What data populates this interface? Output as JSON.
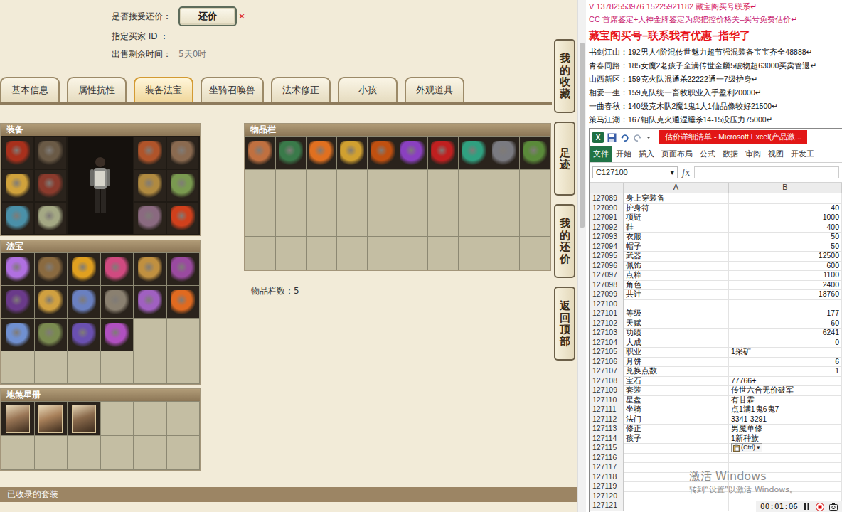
{
  "page": {
    "accept_offer": {
      "label": "是否接受还价：",
      "button": "还价",
      "mark": "✕"
    },
    "buyer": {
      "label": "指定买家 ID ："
    },
    "time_left": {
      "label": "出售剩余时间：",
      "value": "5天0时"
    },
    "tabs": [
      {
        "label": "基本信息",
        "selected": false
      },
      {
        "label": "属性抗性",
        "selected": false
      },
      {
        "label": "装备法宝",
        "selected": true
      },
      {
        "label": "坐骑召唤兽",
        "selected": false
      },
      {
        "label": "法术修正",
        "selected": false
      },
      {
        "label": "小孩",
        "selected": false
      },
      {
        "label": "外观道具",
        "selected": false
      }
    ],
    "equipment": {
      "title": "装备",
      "left_slots": [
        {
          "filled": true,
          "color": "#a8301c"
        },
        {
          "filled": true,
          "color": "#6a5a46"
        },
        {
          "filled": true,
          "color": "#d0a23c"
        },
        {
          "filled": true,
          "color": "#8a3a2c"
        },
        {
          "filled": true,
          "color": "#4a90a8"
        },
        {
          "filled": true,
          "color": "#a4a884"
        }
      ],
      "right_slots": [
        {
          "filled": true,
          "color": "#b0542a"
        },
        {
          "filled": true,
          "color": "#8a6a50"
        },
        {
          "filled": true,
          "color": "#b08a40"
        },
        {
          "filled": true,
          "color": "#7a9a50"
        },
        {
          "filled": true,
          "color": "#8a6a80"
        },
        {
          "filled": true,
          "color": "#d0401c"
        }
      ]
    },
    "magic": {
      "title": "法宝",
      "slots": [
        {
          "filled": true,
          "color": "#b070e0"
        },
        {
          "filled": true,
          "color": "#8a6a40"
        },
        {
          "filled": true,
          "color": "#e0a020"
        },
        {
          "filled": true,
          "color": "#d04a80"
        },
        {
          "filled": true,
          "color": "#c09040"
        },
        {
          "filled": true,
          "color": "#9a4aa0"
        },
        {
          "filled": true,
          "color": "#6a3a8a"
        },
        {
          "filled": true,
          "color": "#d0a040"
        },
        {
          "filled": true,
          "color": "#6a80c0"
        },
        {
          "filled": true,
          "color": "#8a8070"
        },
        {
          "filled": true,
          "color": "#a060c0"
        },
        {
          "filled": true,
          "color": "#e06a20"
        },
        {
          "filled": true,
          "color": "#7090d0"
        },
        {
          "filled": true,
          "color": "#7a8a50"
        },
        {
          "filled": true,
          "color": "#6a50b0"
        },
        {
          "filled": true,
          "color": "#b050c0"
        },
        {
          "filled": false
        },
        {
          "filled": false
        },
        {
          "filled": false
        },
        {
          "filled": false
        },
        {
          "filled": false
        },
        {
          "filled": false
        },
        {
          "filled": false
        },
        {
          "filled": false
        }
      ]
    },
    "stars": {
      "title": "地煞星册",
      "slots": [
        {
          "filled": true,
          "color": "#9a7656"
        },
        {
          "filled": true,
          "color": "#a8805a"
        },
        {
          "filled": true,
          "color": "#8a6a4c"
        },
        {
          "filled": false
        },
        {
          "filled": false
        },
        {
          "filled": false
        },
        {
          "filled": false
        },
        {
          "filled": false
        },
        {
          "filled": false
        },
        {
          "filled": false
        },
        {
          "filled": false
        },
        {
          "filled": false
        }
      ]
    },
    "inventory": {
      "title": "物品栏",
      "count": "物品栏数：5",
      "slots": [
        {
          "filled": true,
          "color": "#c07040"
        },
        {
          "filled": true,
          "color": "#3a7a4a"
        },
        {
          "filled": true,
          "color": "#e07020"
        },
        {
          "filled": true,
          "color": "#d0a030"
        },
        {
          "filled": true,
          "color": "#c05010"
        },
        {
          "filled": true,
          "color": "#8a40c0"
        },
        {
          "filled": true,
          "color": "#c02020"
        },
        {
          "filled": true,
          "color": "#30a080"
        },
        {
          "filled": true,
          "color": "#7a7a80"
        },
        {
          "filled": true,
          "color": "#5a8a3a"
        },
        {
          "filled": false
        },
        {
          "filled": false
        },
        {
          "filled": false
        },
        {
          "filled": false
        },
        {
          "filled": false
        },
        {
          "filled": false
        },
        {
          "filled": false
        },
        {
          "filled": false
        },
        {
          "filled": false
        },
        {
          "filled": false
        },
        {
          "filled": false
        },
        {
          "filled": false
        },
        {
          "filled": false
        },
        {
          "filled": false
        },
        {
          "filled": false
        },
        {
          "filled": false
        },
        {
          "filled": false
        },
        {
          "filled": false
        },
        {
          "filled": false
        },
        {
          "filled": false
        },
        {
          "filled": false
        },
        {
          "filled": false
        },
        {
          "filled": false
        },
        {
          "filled": false
        },
        {
          "filled": false
        },
        {
          "filled": false
        },
        {
          "filled": false
        },
        {
          "filled": false
        },
        {
          "filled": false
        },
        {
          "filled": false
        }
      ]
    },
    "suit_bar": {
      "title": "已收录的套装"
    },
    "side_buttons": [
      {
        "label": "我的收藏"
      },
      {
        "label": "足迹"
      },
      {
        "label": "我的还价"
      },
      {
        "label": "返回顶部"
      }
    ]
  },
  "notes": [
    {
      "text": "V 13782553976   15225921182   藏宝阁买号联系↵",
      "kind": "contact"
    },
    {
      "text": "CC 首席鉴定+大神金牌鉴定为您把控价格关–买号免费估价↵",
      "kind": "promo"
    },
    {
      "text": "藏宝阁买号–联系我有优惠–指华了",
      "kind": "headline"
    },
    {
      "text": "书剑江山：192男人4阶混传世魅力超节强混装备宝宝齐全48888↵",
      "kind": "listing"
    },
    {
      "text": "青春同路：185女魔2老孩子全满传世金麟5破物超63000买卖管退↵",
      "kind": "listing"
    },
    {
      "text": "山西新区：159克火队混通杀22222通一7级护身↵",
      "kind": "listing"
    },
    {
      "text": "相爱一生：159克队统一畜牧职业入手盈利20000↵",
      "kind": "listing"
    },
    {
      "text": "一曲春秋：140级克木队2魔1鬼1人1仙品像较好21500↵",
      "kind": "listing"
    },
    {
      "text": "策马江湖：167钼队克火通涅睡杀14-15没压力75000↵",
      "kind": "listing"
    }
  ],
  "excel": {
    "logo": "X",
    "title": "估价详细清单 - Microsoft Excel(产品激...",
    "ribbon_tabs": [
      {
        "label": "文件",
        "selected": true
      },
      {
        "label": "开始",
        "selected": false
      },
      {
        "label": "插入",
        "selected": false
      },
      {
        "label": "页面布局",
        "selected": false
      },
      {
        "label": "公式",
        "selected": false
      },
      {
        "label": "数据",
        "selected": false
      },
      {
        "label": "审阅",
        "selected": false
      },
      {
        "label": "视图",
        "selected": false
      },
      {
        "label": "开发工",
        "selected": false
      }
    ],
    "name_box": "C127100",
    "name_box_arrow": "▾",
    "fx": "fx",
    "columns": [
      "A",
      "B"
    ],
    "paste_button": {
      "label": "(Ctrl)",
      "arrow": "▾"
    },
    "rows": [
      {
        "n": "127089",
        "a": "身上穿装备",
        "b": "",
        "kind": "text",
        "paste": false
      },
      {
        "n": "127090",
        "a": "护身符",
        "b": "40",
        "kind": "number",
        "paste": false
      },
      {
        "n": "127091",
        "a": "项链",
        "b": "1000",
        "kind": "number",
        "paste": false
      },
      {
        "n": "127092",
        "a": "鞋",
        "b": "400",
        "kind": "number",
        "paste": false
      },
      {
        "n": "127093",
        "a": "衣服",
        "b": "50",
        "kind": "number",
        "paste": false
      },
      {
        "n": "127094",
        "a": "帽子",
        "b": "50",
        "kind": "number",
        "paste": false
      },
      {
        "n": "127095",
        "a": "武器",
        "b": "12500",
        "kind": "number",
        "paste": false
      },
      {
        "n": "127096",
        "a": "佩饰",
        "b": "600",
        "kind": "number",
        "paste": false
      },
      {
        "n": "127097",
        "a": "点粹",
        "b": "1100",
        "kind": "number",
        "paste": false
      },
      {
        "n": "127098",
        "a": "角色",
        "b": "2400",
        "kind": "number",
        "paste": false
      },
      {
        "n": "127099",
        "a": "共计",
        "b": "18760",
        "kind": "number",
        "paste": false
      },
      {
        "n": "127100",
        "a": "",
        "b": "",
        "kind": "text",
        "paste": false
      },
      {
        "n": "127101",
        "a": "等级",
        "b": "177",
        "kind": "number",
        "paste": false
      },
      {
        "n": "127102",
        "a": "天赋",
        "b": "60",
        "kind": "number",
        "paste": false
      },
      {
        "n": "127103",
        "a": "功绩",
        "b": "6241",
        "kind": "number",
        "paste": false
      },
      {
        "n": "127104",
        "a": "大成",
        "b": "0",
        "kind": "number",
        "paste": false
      },
      {
        "n": "127105",
        "a": "职业",
        "b": "1采矿",
        "kind": "text",
        "paste": false
      },
      {
        "n": "127106",
        "a": "月饼",
        "b": "6",
        "kind": "number",
        "paste": false
      },
      {
        "n": "127107",
        "a": "兑换点数",
        "b": "1",
        "kind": "number",
        "paste": false
      },
      {
        "n": "127108",
        "a": "宝石",
        "b": "77766+",
        "kind": "text",
        "paste": false
      },
      {
        "n": "127109",
        "a": "套装",
        "b": "传世六合无价破军",
        "kind": "text",
        "paste": false
      },
      {
        "n": "127110",
        "a": "星盘",
        "b": "有甘霖",
        "kind": "text",
        "paste": false
      },
      {
        "n": "127111",
        "a": "坐骑",
        "b": "点1满1鬼6鬼7",
        "kind": "text",
        "paste": false
      },
      {
        "n": "127112",
        "a": "法门",
        "b": "3341-3291",
        "kind": "text",
        "paste": false
      },
      {
        "n": "127113",
        "a": "修正",
        "b": "男魔单修",
        "kind": "text",
        "paste": false
      },
      {
        "n": "127114",
        "a": "孩子",
        "b": "1新种族",
        "kind": "text",
        "paste": false
      },
      {
        "n": "127115",
        "a": "",
        "b": "",
        "kind": "text",
        "paste": true
      },
      {
        "n": "127116",
        "a": "",
        "b": "",
        "kind": "text",
        "paste": false
      },
      {
        "n": "127117",
        "a": "",
        "b": "",
        "kind": "text",
        "paste": false
      },
      {
        "n": "127118",
        "a": "",
        "b": "",
        "kind": "text",
        "paste": false
      },
      {
        "n": "127119",
        "a": "",
        "b": "",
        "kind": "text",
        "paste": false
      },
      {
        "n": "127120",
        "a": "",
        "b": "",
        "kind": "text",
        "paste": false
      },
      {
        "n": "127121",
        "a": "",
        "b": "",
        "kind": "text",
        "paste": false
      }
    ]
  },
  "watermark": {
    "title": "激活 Windows",
    "subtitle": "转到“设置”以激活 Windows。"
  },
  "recorder": {
    "time": "00:01:06"
  }
}
